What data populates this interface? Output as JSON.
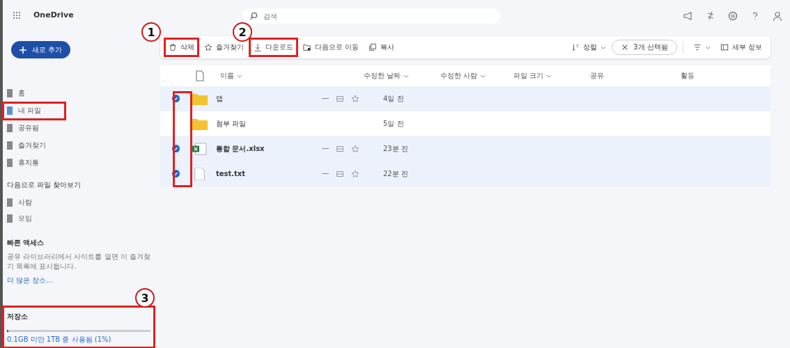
{
  "app": {
    "name": "OneDrive"
  },
  "search": {
    "placeholder": "검색"
  },
  "new_button": {
    "label": "새로 추가"
  },
  "nav": [
    {
      "label": "홈",
      "selected": false,
      "highlighted": false
    },
    {
      "label": "내 파일",
      "selected": true,
      "highlighted": true
    },
    {
      "label": "공유됨",
      "selected": false,
      "highlighted": false
    },
    {
      "label": "즐겨찾기",
      "selected": false,
      "highlighted": false
    },
    {
      "label": "휴지통",
      "selected": false,
      "highlighted": false
    }
  ],
  "browse": {
    "title": "다음으로 파일 찾아보기",
    "items": [
      {
        "label": "사람"
      },
      {
        "label": "모임"
      }
    ]
  },
  "quick_access": {
    "title": "빠른 액세스",
    "description": "공유 라이브러리에서 사이트를 열면 이 즐겨찾기 목록에 표시됩니다.",
    "link": "더 많은 장소..."
  },
  "storage": {
    "title": "저장소",
    "usage": "0.1GB 미만 1TB 중 사용됨 (1%)",
    "level": 0.01,
    "highlighted": true
  },
  "toolbar": [
    {
      "kind": "trash",
      "label": "삭제",
      "highlighted": true
    },
    {
      "kind": "star",
      "label": "즐겨찾기",
      "highlighted": false
    },
    {
      "kind": "download",
      "label": "다운로드",
      "highlighted": true
    },
    {
      "kind": "move",
      "label": "다음으로 이동",
      "highlighted": false
    },
    {
      "kind": "copy",
      "label": "복사",
      "highlighted": false
    }
  ],
  "sort": {
    "label": "정렬"
  },
  "selection": {
    "label": "3개 선택됨"
  },
  "details": {
    "label": "세부 정보"
  },
  "table": {
    "columns": [
      "이름",
      "수정한 날짜",
      "수정한 사람",
      "파일 크기",
      "공유",
      "활동"
    ],
    "rows": [
      {
        "kind": "folder",
        "name": "앱",
        "modified": "4일 전",
        "selected": true
      },
      {
        "kind": "folder",
        "name": "첨부 파일",
        "modified": "5일 전",
        "selected": false
      },
      {
        "kind": "excel",
        "name": "통합 문서.xlsx",
        "modified": "23분 전",
        "selected": true
      },
      {
        "kind": "text",
        "name": "test.txt",
        "modified": "22분 전",
        "selected": true
      }
    ]
  },
  "callouts": [
    {
      "label": "1"
    },
    {
      "label": "2"
    },
    {
      "label": "3"
    }
  ]
}
